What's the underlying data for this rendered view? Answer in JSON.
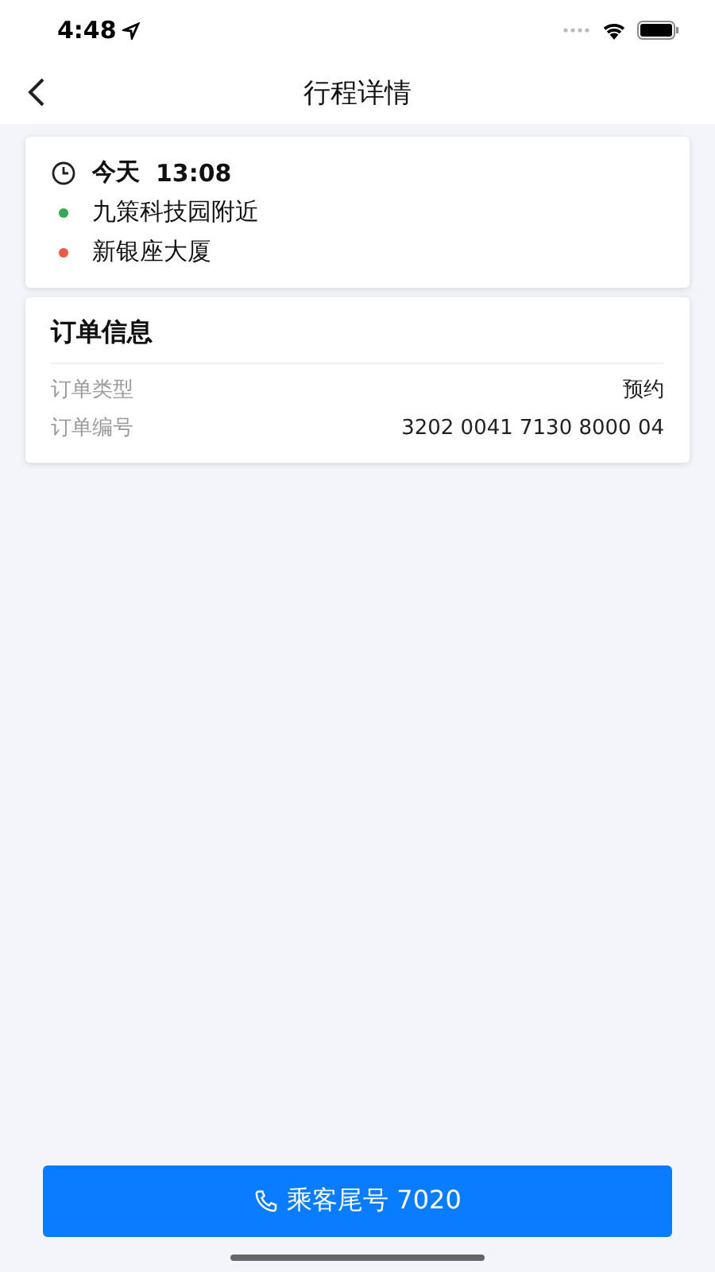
{
  "status_bar": {
    "time": "4:48"
  },
  "nav": {
    "title": "行程详情"
  },
  "trip": {
    "day": "今天",
    "time": "13:08",
    "stops": [
      {
        "name": "九策科技园附近",
        "color": "#34a853"
      },
      {
        "name": "新银座大厦",
        "color": "#ea5a47"
      }
    ]
  },
  "order_info": {
    "title": "订单信息",
    "rows": [
      {
        "label": "订单类型",
        "value": "预约"
      },
      {
        "label": "订单编号",
        "value": "3202 0041 7130 8000 04"
      }
    ]
  },
  "call_button": {
    "label": "乘客尾号 7020"
  }
}
